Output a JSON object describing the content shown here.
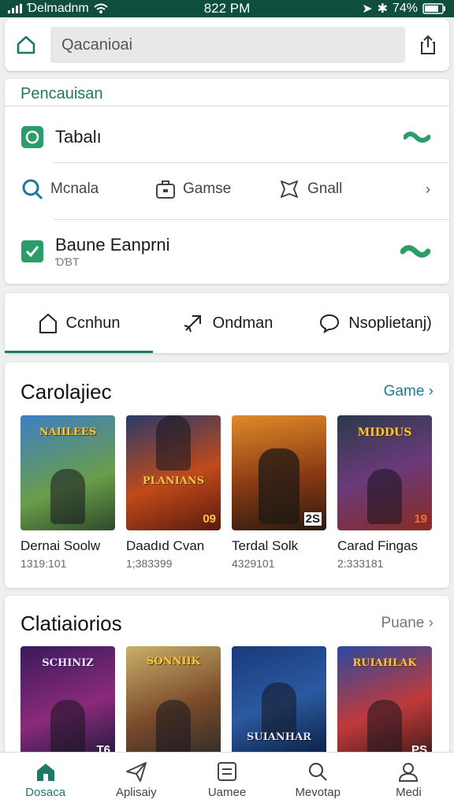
{
  "status": {
    "carrier": "Ɗelmadnm",
    "time": "822 PM",
    "battery": "74%"
  },
  "search": {
    "placeholder": "Qacanioai"
  },
  "menu": {
    "title": "Pencauisan",
    "row1_label": "Tabalı",
    "chips": [
      {
        "icon": "search-icon",
        "label": "Mcnala"
      },
      {
        "icon": "briefcase-icon",
        "label": "Gamse"
      },
      {
        "icon": "star-icon",
        "label": "Gnall"
      }
    ],
    "row3_label": "Baune Eanprni",
    "row3_sub": "ƊƁT"
  },
  "tabs": [
    {
      "icon": "home-icon",
      "label": "Ccnhun",
      "active": true
    },
    {
      "icon": "rocket-icon",
      "label": "Ondman",
      "active": false
    },
    {
      "icon": "chat-icon",
      "label": "Nsoplietanj)",
      "active": false
    }
  ],
  "section1": {
    "title": "Carolajiec",
    "link": "Game",
    "games": [
      {
        "cover_title": "NAIILEES",
        "badge": "",
        "name": "Dernai Soolw",
        "count": "1319:101"
      },
      {
        "cover_title": "PLANIANS",
        "badge": "09",
        "name": "Daadıd Cvan",
        "count": "1;383399"
      },
      {
        "cover_title": "",
        "badge": "2S",
        "name": "Terdal Solk",
        "count": "4329101"
      },
      {
        "cover_title": "MIDDUS",
        "badge": "19",
        "name": "Carad Fingas",
        "count": "2:333181"
      }
    ]
  },
  "section2": {
    "title": "Clatiaiorios",
    "link": "Puane",
    "games": [
      {
        "cover_title": "SCHINIZ",
        "badge": "T6"
      },
      {
        "cover_title": "SONNIIK",
        "badge": ""
      },
      {
        "cover_title": "SUIANHAR",
        "badge": ""
      },
      {
        "cover_title": "RUIAHLAK",
        "badge": "PS"
      }
    ]
  },
  "nav": [
    {
      "icon": "home-icon",
      "label": "Dosaca",
      "active": true
    },
    {
      "icon": "plane-icon",
      "label": "Aplisaiy",
      "active": false
    },
    {
      "icon": "list-icon",
      "label": "Uamee",
      "active": false
    },
    {
      "icon": "search-icon",
      "label": "Mevotap",
      "active": false
    },
    {
      "icon": "profile-icon",
      "label": "Medi",
      "active": false
    }
  ],
  "colors": {
    "accent": "#1b7a67",
    "status_bar": "#0f4d3c",
    "link": "#1b7a9c"
  }
}
